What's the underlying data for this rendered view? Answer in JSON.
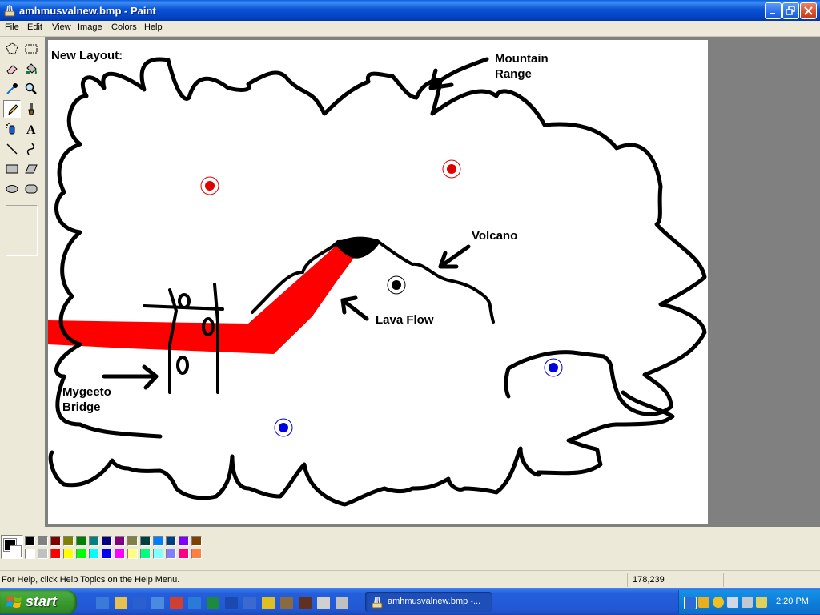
{
  "window": {
    "title": "amhmusvalnew.bmp - Paint",
    "controls": [
      "minimize",
      "maximize",
      "close"
    ]
  },
  "menu": [
    {
      "label": "File",
      "accel": "F"
    },
    {
      "label": "Edit",
      "accel": "E"
    },
    {
      "label": "View",
      "accel": "V"
    },
    {
      "label": "Image",
      "accel": "I"
    },
    {
      "label": "Colors",
      "accel": "C"
    },
    {
      "label": "Help",
      "accel": "H"
    }
  ],
  "tools": [
    {
      "name": "free-form-select",
      "icon": "lasso-icon"
    },
    {
      "name": "select",
      "icon": "rect-select-icon"
    },
    {
      "name": "eraser",
      "icon": "eraser-icon"
    },
    {
      "name": "fill",
      "icon": "paint-bucket-icon"
    },
    {
      "name": "pick-color",
      "icon": "eyedropper-icon"
    },
    {
      "name": "magnifier",
      "icon": "magnifier-icon"
    },
    {
      "name": "pencil",
      "icon": "pencil-icon",
      "selected": true
    },
    {
      "name": "brush",
      "icon": "brush-icon"
    },
    {
      "name": "airbrush",
      "icon": "airbrush-icon"
    },
    {
      "name": "text",
      "icon": "text-icon"
    },
    {
      "name": "line",
      "icon": "line-icon"
    },
    {
      "name": "curve",
      "icon": "curve-icon"
    },
    {
      "name": "rectangle",
      "icon": "rectangle-icon"
    },
    {
      "name": "polygon",
      "icon": "polygon-icon"
    },
    {
      "name": "ellipse",
      "icon": "ellipse-icon"
    },
    {
      "name": "rounded-rectangle",
      "icon": "rounded-rect-icon"
    }
  ],
  "canvas": {
    "title_text": "New Layout:",
    "labels": {
      "mountain": "Mountain\nRange",
      "volcano": "Volcano",
      "lava": "Lava Flow",
      "bridge": "Mygeeto\nBridge"
    },
    "colors": {
      "outline": "#000000",
      "lava": "#ff0000",
      "red_marker": "#e00000",
      "blue_marker": "#0000e0",
      "black_marker": "#000000"
    }
  },
  "palette": {
    "foreground": "#000000",
    "background": "#ffffff",
    "colors": [
      "#000000",
      "#808080",
      "#800000",
      "#808000",
      "#008000",
      "#008080",
      "#000080",
      "#800080",
      "#808040",
      "#004040",
      "#0080ff",
      "#004080",
      "#8000ff",
      "#804000",
      "#ffffff",
      "#c0c0c0",
      "#ff0000",
      "#ffff00",
      "#00ff00",
      "#00ffff",
      "#0000ff",
      "#ff00ff",
      "#ffff80",
      "#00ff80",
      "#80ffff",
      "#8080ff",
      "#ff0080",
      "#ff8040"
    ]
  },
  "status": {
    "help_text": "For Help, click Help Topics on the Help Menu.",
    "coordinates": "178,239",
    "size": ""
  },
  "taskbar": {
    "start_label": "start",
    "quick_launch": [
      "outlook-icon",
      "folder-icon",
      "media-icon",
      "ie-window-icon",
      "eye-icon",
      "ie-icon",
      "excel-icon",
      "word-icon",
      "app-icon",
      "app2-icon",
      "app3-icon",
      "app4-icon",
      "app5-icon",
      "app6-icon"
    ],
    "task_button_label": "amhmusvalnew.bmp -...",
    "clock": "2:20 PM"
  }
}
